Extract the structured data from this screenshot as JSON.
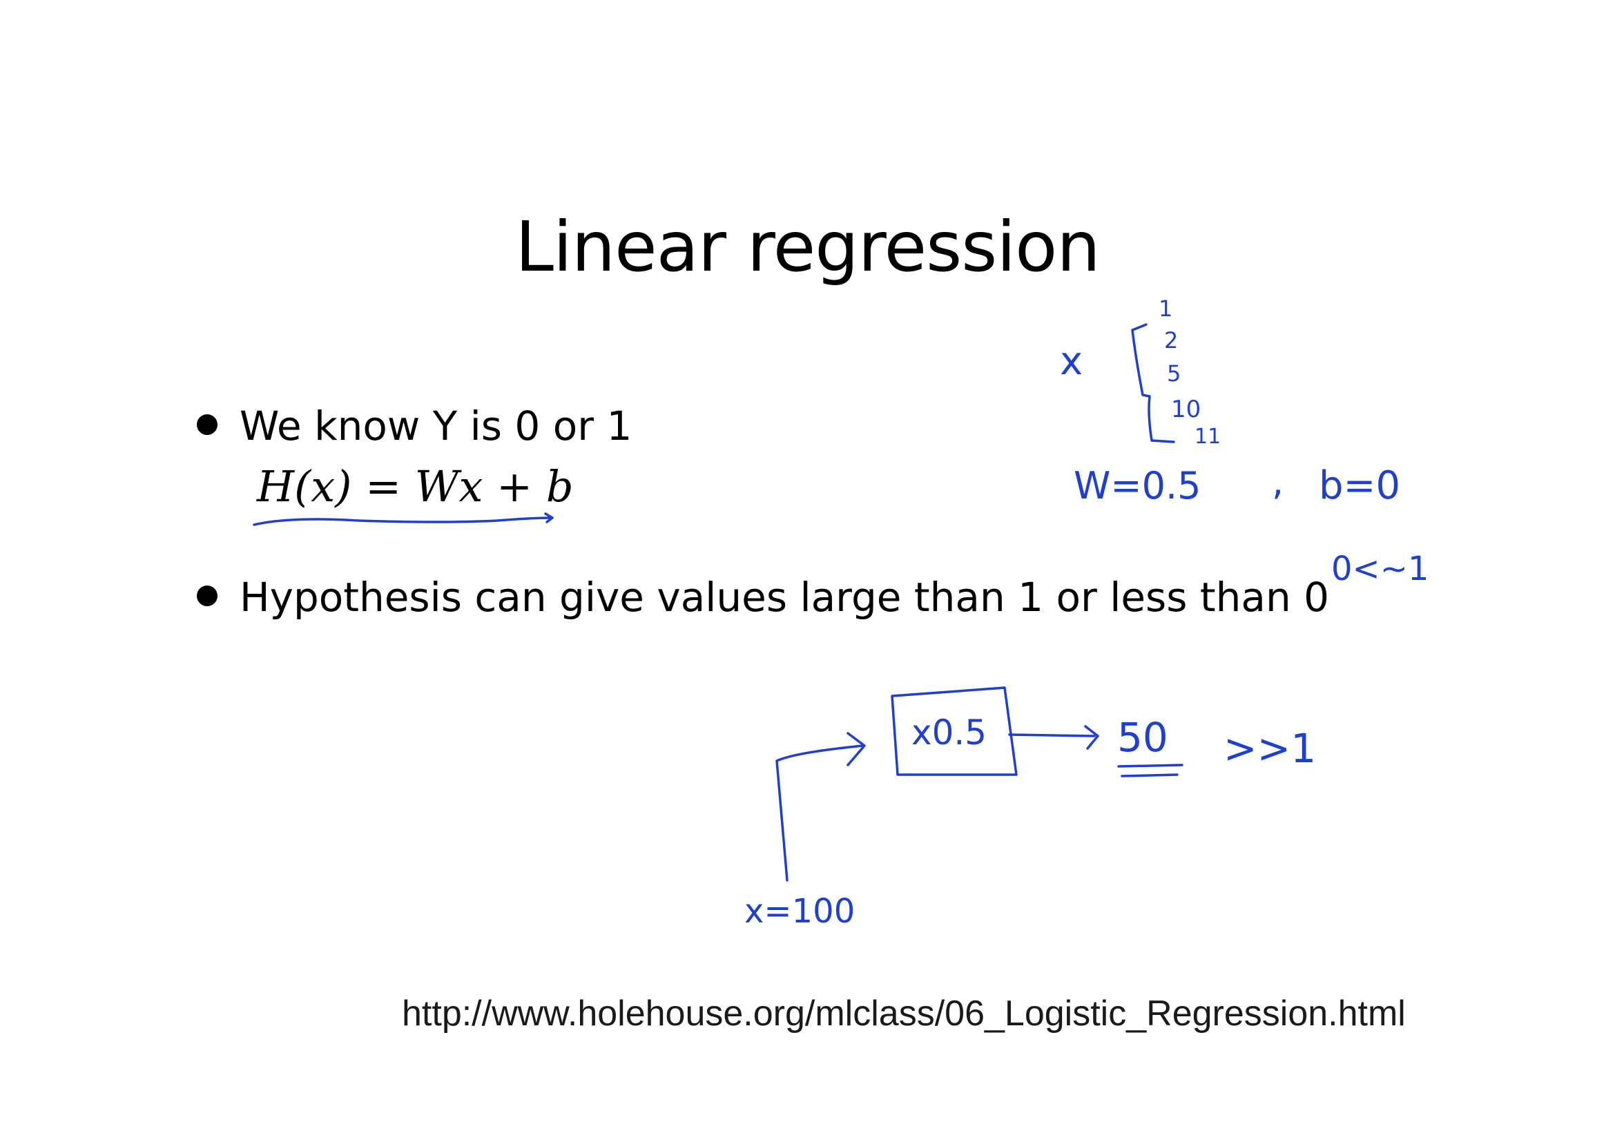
{
  "slide": {
    "title": "Linear regression",
    "bullets": [
      {
        "text": "We know Y is 0 or 1"
      },
      {
        "text": "Hypothesis can give values large than 1 or less than 0"
      }
    ],
    "formula": "H(x) = Wx + b",
    "source_url": "http://www.holehouse.org/mlclass/06_Logistic_Regression.html"
  },
  "annotations": {
    "x_label": "x",
    "x_values": [
      "1",
      "2",
      "5",
      "10",
      "11"
    ],
    "w_value": "W=0.5",
    "comma": ",",
    "b_value": "b=0",
    "range_note": "0<~1",
    "box_label": "x0.5",
    "output_value": "50",
    "much_greater": ">>1",
    "input_value": "x=100",
    "ink_color": "#1f3fd0"
  }
}
